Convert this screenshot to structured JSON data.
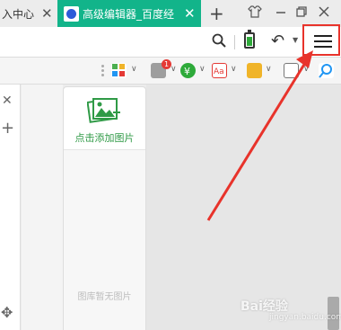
{
  "tabs": [
    {
      "label": "入中心",
      "active": false
    },
    {
      "label": "高级编辑器_百度经",
      "active": true
    }
  ],
  "window_controls": [
    "skin-icon",
    "minimize-icon",
    "restore-icon",
    "close-icon"
  ],
  "toolbar": {
    "new_tab": "+",
    "undo": "↶"
  },
  "extensions": [
    {
      "name": "apps-ext",
      "color": "#4caf50"
    },
    {
      "name": "notify-ext",
      "color": "#9e9e9e",
      "badge": "1"
    },
    {
      "name": "shopping-ext",
      "color": "#2eaa3a"
    },
    {
      "name": "translate-ext",
      "color": "#e53935",
      "text": "Aa"
    },
    {
      "name": "screenshot-ext",
      "color": "#f0b429"
    },
    {
      "name": "game-ext",
      "color": "#777"
    }
  ],
  "image_panel": {
    "add_label": "点击添加图片",
    "empty_label": "图库暂无图片"
  },
  "watermark": {
    "main": "Bai经验",
    "sub": "jingyan.baidu.com"
  },
  "colors": {
    "active_tab": "#12b48a",
    "highlight": "#e8332b",
    "accent_green": "#2f9a46"
  }
}
